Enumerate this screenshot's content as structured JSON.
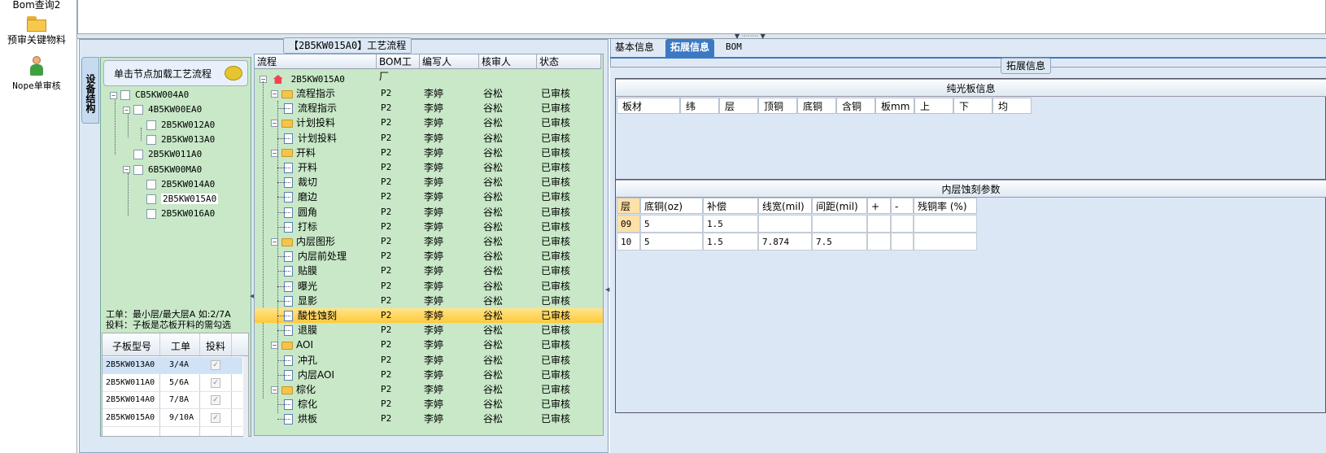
{
  "left_nav": {
    "items": [
      {
        "label": "Bom查询2",
        "icon": "folder-icon"
      },
      {
        "label": "预审关键物料",
        "icon": "folder-icon"
      },
      {
        "label": "Nope单审核",
        "icon": "user-icon"
      }
    ]
  },
  "process_panel": {
    "title": "【2B5KW015A0】工艺流程"
  },
  "device_panel": {
    "tab_label": "设备结构",
    "hint": "单击节点加载工艺流程",
    "tree": [
      {
        "label": "CB5KW004A0",
        "level": 0
      },
      {
        "label": "4B5KW00EA0",
        "level": 1
      },
      {
        "label": "2B5KW012A0",
        "level": 2
      },
      {
        "label": "2B5KW013A0",
        "level": 2
      },
      {
        "label": "2B5KW011A0",
        "level": 1
      },
      {
        "label": "6B5KW00MA0",
        "level": 1
      },
      {
        "label": "2B5KW014A0",
        "level": 2
      },
      {
        "label": "2B5KW015A0",
        "level": 2
      },
      {
        "label": "2B5KW016A0",
        "level": 2
      }
    ],
    "note_line1": "工单：最小层/最大层A 如:2/7A",
    "note_line2": "投料：子板是芯板开料的需勾选",
    "subtable": {
      "headers": [
        "子板型号",
        "工单",
        "投料"
      ],
      "rows": [
        {
          "model": "2B5KW013A0",
          "order": "3/4A",
          "checked": true
        },
        {
          "model": "2B5KW011A0",
          "order": "5/6A",
          "checked": true
        },
        {
          "model": "2B5KW014A0",
          "order": "7/8A",
          "checked": true
        },
        {
          "model": "2B5KW015A0",
          "order": "9/10A",
          "checked": true
        }
      ]
    }
  },
  "process_grid": {
    "headers": [
      "流程",
      "BOM工厂",
      "编写人",
      "核审人",
      "状态"
    ],
    "root": "2B5KW015A0",
    "rows": [
      {
        "name": "流程指示",
        "type": "folder",
        "factory": "P2",
        "writer": "李婷",
        "reviewer": "谷松",
        "status": "已审核"
      },
      {
        "name": "流程指示",
        "type": "doc",
        "factory": "P2",
        "writer": "李婷",
        "reviewer": "谷松",
        "status": "已审核"
      },
      {
        "name": "计划投料",
        "type": "folder",
        "factory": "P2",
        "writer": "李婷",
        "reviewer": "谷松",
        "status": "已审核"
      },
      {
        "name": "计划投料",
        "type": "doc",
        "factory": "P2",
        "writer": "李婷",
        "reviewer": "谷松",
        "status": "已审核"
      },
      {
        "name": "开料",
        "type": "folder",
        "factory": "P2",
        "writer": "李婷",
        "reviewer": "谷松",
        "status": "已审核"
      },
      {
        "name": "开料",
        "type": "doc",
        "factory": "P2",
        "writer": "李婷",
        "reviewer": "谷松",
        "status": "已审核"
      },
      {
        "name": "裁切",
        "type": "doc",
        "factory": "P2",
        "writer": "李婷",
        "reviewer": "谷松",
        "status": "已审核"
      },
      {
        "name": "磨边",
        "type": "doc",
        "factory": "P2",
        "writer": "李婷",
        "reviewer": "谷松",
        "status": "已审核"
      },
      {
        "name": "圆角",
        "type": "doc",
        "factory": "P2",
        "writer": "李婷",
        "reviewer": "谷松",
        "status": "已审核"
      },
      {
        "name": "打标",
        "type": "doc",
        "factory": "P2",
        "writer": "李婷",
        "reviewer": "谷松",
        "status": "已审核"
      },
      {
        "name": "内层图形",
        "type": "folder",
        "factory": "P2",
        "writer": "李婷",
        "reviewer": "谷松",
        "status": "已审核"
      },
      {
        "name": "内层前处理",
        "type": "doc",
        "factory": "P2",
        "writer": "李婷",
        "reviewer": "谷松",
        "status": "已审核"
      },
      {
        "name": "贴膜",
        "type": "doc",
        "factory": "P2",
        "writer": "李婷",
        "reviewer": "谷松",
        "status": "已审核"
      },
      {
        "name": "曝光",
        "type": "doc",
        "factory": "P2",
        "writer": "李婷",
        "reviewer": "谷松",
        "status": "已审核"
      },
      {
        "name": "显影",
        "type": "doc",
        "factory": "P2",
        "writer": "李婷",
        "reviewer": "谷松",
        "status": "已审核"
      },
      {
        "name": "酸性蚀刻",
        "type": "doc",
        "factory": "P2",
        "writer": "李婷",
        "reviewer": "谷松",
        "status": "已审核",
        "selected": true
      },
      {
        "name": "退膜",
        "type": "doc",
        "factory": "P2",
        "writer": "李婷",
        "reviewer": "谷松",
        "status": "已审核"
      },
      {
        "name": "AOI",
        "type": "folder",
        "factory": "P2",
        "writer": "李婷",
        "reviewer": "谷松",
        "status": "已审核"
      },
      {
        "name": "冲孔",
        "type": "doc",
        "factory": "P2",
        "writer": "李婷",
        "reviewer": "谷松",
        "status": "已审核"
      },
      {
        "name": "内层AOI",
        "type": "doc",
        "factory": "P2",
        "writer": "李婷",
        "reviewer": "谷松",
        "status": "已审核"
      },
      {
        "name": "棕化",
        "type": "folder",
        "factory": "P2",
        "writer": "李婷",
        "reviewer": "谷松",
        "status": "已审核"
      },
      {
        "name": "棕化",
        "type": "doc",
        "factory": "P2",
        "writer": "李婷",
        "reviewer": "谷松",
        "status": "已审核"
      },
      {
        "name": "烘板",
        "type": "doc",
        "factory": "P2",
        "writer": "李婷",
        "reviewer": "谷松",
        "status": "已审核"
      }
    ]
  },
  "right_panel": {
    "tabs": [
      "基本信息",
      "拓展信息",
      "BOM"
    ],
    "active_tab": "拓展信息",
    "group_title": "拓展信息",
    "section1": {
      "title": "纯光板信息",
      "headers": [
        "板材",
        "纬",
        "层",
        "顶铜",
        "底铜",
        "含铜",
        "板mm",
        "上",
        "下",
        "均"
      ]
    },
    "section2": {
      "title": "内层蚀刻参数",
      "headers": [
        "层",
        "底铜(oz)",
        "补偿",
        "线宽(mil)",
        "间距(mil)",
        "+",
        "-",
        "残铜率 (%)"
      ],
      "rows": [
        [
          "09",
          "5",
          "1.5",
          "",
          "",
          "",
          "",
          ""
        ],
        [
          "10",
          "5",
          "1.5",
          "7.874",
          "7.5",
          "",
          "",
          ""
        ]
      ]
    }
  },
  "colors": {
    "accent": "#3c79c4",
    "grid_bg": "#c8e8c8",
    "selected_row": "#ffc93a",
    "panel_bg": "#dce8f4"
  }
}
